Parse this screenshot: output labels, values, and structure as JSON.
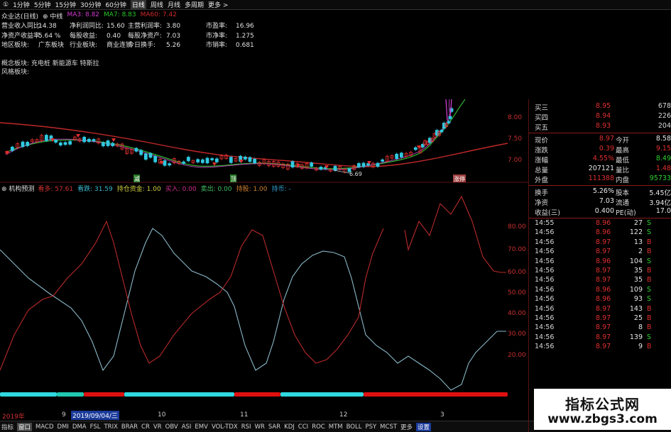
{
  "topbar": {
    "tabs": [
      "①",
      "1分钟",
      "5分钟",
      "15分钟",
      "30分钟",
      "60分钟",
      "日线",
      "周线",
      "月线",
      "多周期",
      "更多 >"
    ],
    "selected": 6
  },
  "stock": {
    "name": "众业达(日线)",
    "icon_label": "⊕ 中线",
    "ma3": "MA3: 8.82",
    "ma7": "MA7: 8.83",
    "ma60": "MA60: 7.42",
    "colors": {
      "ma3": "#d13ad1",
      "ma7": "#28c828",
      "ma60": "#d02828"
    }
  },
  "fundamentals": [
    [
      "营业收入同比:",
      "14.38",
      "净利润同比:",
      "15.60",
      "主营利润率:",
      "3.80",
      "市盈率:",
      "16.96"
    ],
    [
      "净资产收益率:",
      "5.64 %",
      "每股收益:",
      "0.40",
      "每股净资产:",
      "7.03",
      "市净率:",
      "1.275"
    ],
    [
      "地区板块:",
      "广东板块",
      "行业板块:",
      "商业连锁",
      "今日换手:",
      "5.26",
      "市销率:",
      "0.681"
    ]
  ],
  "concepts": {
    "l1": "概念板块:  充电桩 新能源车 特斯拉",
    "l2": "风格板块:"
  },
  "price_chart": {
    "axis": [
      "8.00",
      "7.50",
      "7.00"
    ],
    "low_label": "6.69",
    "sig1": "减",
    "sig2": "顶",
    "sig3": "涨停"
  },
  "indicator": {
    "title": "⊕ 机构预测",
    "items": [
      [
        "看多: 57.61",
        "#d03030"
      ],
      [
        "看跌: 31.59",
        "#38b8d0"
      ],
      [
        "持仓资金: 1.00",
        "#d0d040"
      ],
      [
        "买入: 0.00",
        "#d03090"
      ],
      [
        "卖出: 0.00",
        "#40c060"
      ],
      [
        "持股: 1.00",
        "#d08030"
      ],
      [
        "持币: -",
        "#30a0d0"
      ]
    ],
    "axis": [
      "80.00",
      "70.00",
      "60.00",
      "50.00",
      "40.00",
      "30.00",
      "20.00"
    ]
  },
  "dates": {
    "d1": "2019年",
    "d2": "9",
    "d3": "2019/09/04/三",
    "d4": "10",
    "d5": "11",
    "d6": "12",
    "d7": "3"
  },
  "bottom_tabs": [
    "指标",
    "窗口",
    "MACD",
    "DMI",
    "DMA",
    "FSL",
    "TRIX",
    "BRAR",
    "CR",
    "VR",
    "OBV",
    "ASI",
    "EMV",
    "VOL-TDX",
    "RSI",
    "WR",
    "SAR",
    "KDJ",
    "CCI",
    "ROC",
    "MTM",
    "BOLL",
    "PSY",
    "MCST",
    "更多",
    "设置"
  ],
  "bottom_right": "模板",
  "quotes": {
    "asks": [
      [
        "买三",
        "8.95",
        "678"
      ],
      [
        "买四",
        "8.94",
        "226"
      ],
      [
        "买五",
        "8.93",
        "204"
      ]
    ],
    "stats": [
      [
        "现价",
        "8.97",
        "今开",
        "8.58"
      ],
      [
        "涨跌",
        "0.39",
        "最高",
        "9.15"
      ],
      [
        "涨幅",
        "4.55%",
        "最低",
        "8.49"
      ],
      [
        "总量",
        "207121",
        "量比",
        "1.48"
      ],
      [
        "外盘",
        "111388",
        "内盘",
        "95733"
      ]
    ],
    "stats2": [
      [
        "换手",
        "5.26%",
        "股本",
        "5.45亿"
      ],
      [
        "净资",
        "7.03",
        "流通",
        "3.94亿"
      ],
      [
        "收益(三)",
        "0.400",
        "PE(动)",
        "17.0"
      ]
    ],
    "ticks": [
      [
        "14:55",
        "8.96",
        "27",
        "S"
      ],
      [
        "14:56",
        "8.96",
        "122",
        "S"
      ],
      [
        "14:56",
        "8.97",
        "13",
        "B"
      ],
      [
        "14:56",
        "8.97",
        "2",
        "B"
      ],
      [
        "14:56",
        "8.96",
        "104",
        "S"
      ],
      [
        "14:56",
        "8.97",
        "35",
        "B"
      ],
      [
        "14:56",
        "8.97",
        "35",
        "B"
      ],
      [
        "14:56",
        "8.96",
        "109",
        "S"
      ],
      [
        "14:56",
        "8.96",
        "93",
        "S"
      ],
      [
        "14:56",
        "8.97",
        "143",
        "B"
      ],
      [
        "14:56",
        "8.97",
        "25",
        "B"
      ],
      [
        "14:56",
        "8.97",
        "8",
        "B"
      ],
      [
        "14:56",
        "8.97",
        "139",
        "S"
      ],
      [
        "14:56",
        "8.97",
        "9",
        "B"
      ]
    ]
  },
  "watermark": {
    "l1": "指标公式网",
    "l2": "www.zbgs3.com"
  }
}
